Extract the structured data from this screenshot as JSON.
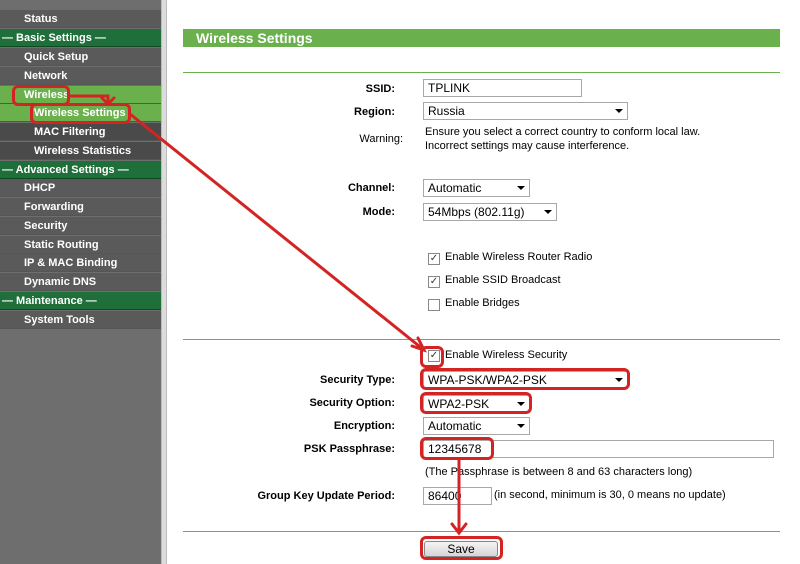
{
  "sidebar": {
    "items": [
      {
        "label": "Status"
      },
      {
        "label": "— Basic Settings —"
      },
      {
        "label": "Quick Setup"
      },
      {
        "label": "Network"
      },
      {
        "label": "Wireless"
      },
      {
        "label": "Wireless Settings"
      },
      {
        "label": "MAC Filtering"
      },
      {
        "label": "Wireless Statistics"
      },
      {
        "label": "— Advanced Settings —"
      },
      {
        "label": "DHCP"
      },
      {
        "label": "Forwarding"
      },
      {
        "label": "Security"
      },
      {
        "label": "Static Routing"
      },
      {
        "label": "IP & MAC Binding"
      },
      {
        "label": "Dynamic DNS"
      },
      {
        "label": "— Maintenance —"
      },
      {
        "label": "System Tools"
      }
    ]
  },
  "page": {
    "title": "Wireless Settings"
  },
  "form": {
    "ssid_label": "SSID:",
    "ssid_value": "TPLINK",
    "region_label": "Region:",
    "region_value": "Russia",
    "warning_label": "Warning:",
    "warning_line1": "Ensure you select a correct country to conform local law.",
    "warning_line2": "Incorrect settings may cause interference.",
    "channel_label": "Channel:",
    "channel_value": "Automatic",
    "mode_label": "Mode:",
    "mode_value": "54Mbps (802.11g)",
    "enable_radio": "Enable Wireless Router Radio",
    "enable_ssid_broadcast": "Enable SSID Broadcast",
    "enable_bridges": "Enable Bridges",
    "enable_security": "Enable Wireless Security",
    "security_type_label": "Security Type:",
    "security_type_value": "WPA-PSK/WPA2-PSK",
    "security_option_label": "Security Option:",
    "security_option_value": "WPA2-PSK",
    "encryption_label": "Encryption:",
    "encryption_value": "Automatic",
    "psk_label": "PSK Passphrase:",
    "psk_value": "12345678",
    "psk_hint": "(The Passphrase is between 8 and 63 characters long)",
    "group_key_label": "Group Key Update Period:",
    "group_key_value": "86400",
    "group_key_hint": "(in second, minimum is 30, 0 means no update)",
    "save_label": "Save",
    "checked_mark": "✓"
  },
  "colors": {
    "accent": "#6ab04c",
    "section": "#1f6f3a",
    "annotation": "#d42323"
  }
}
